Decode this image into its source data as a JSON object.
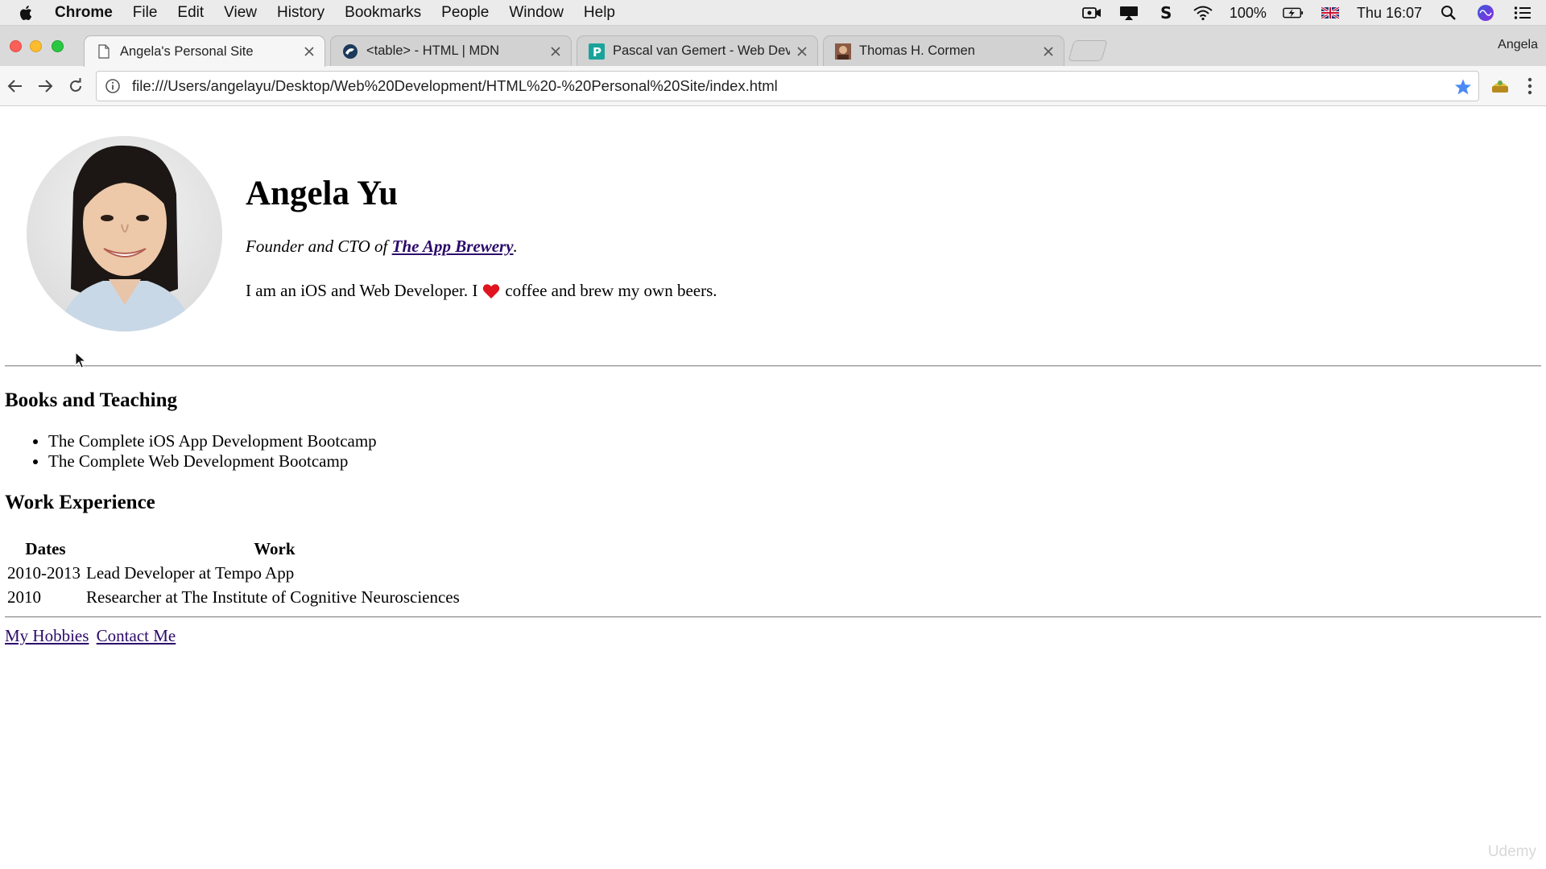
{
  "menubar": {
    "app_name": "Chrome",
    "items": [
      "File",
      "Edit",
      "View",
      "History",
      "Bookmarks",
      "People",
      "Window",
      "Help"
    ],
    "battery": "100%",
    "clock": "Thu 16:07"
  },
  "tabs": [
    {
      "title": "Angela's Personal Site",
      "favicon": "page-icon"
    },
    {
      "title": "<table> - HTML | MDN",
      "favicon": "mdn-icon"
    },
    {
      "title": "Pascal van Gemert - Web Developer",
      "favicon": "pascal-p-icon"
    },
    {
      "title": "Thomas H. Cormen",
      "favicon": "cormen-photo-icon"
    }
  ],
  "profile_name": "Angela",
  "toolbar": {
    "url": "file:///Users/angelayu/Desktop/Web%20Development/HTML%20-%20Personal%20Site/index.html"
  },
  "page": {
    "name": "Angela Yu",
    "tagline_prefix": "Founder and CTO of ",
    "tagline_link": "The App Brewery",
    "tagline_suffix": ".",
    "bio_before": "I am an iOS and Web Developer. I",
    "bio_after": "coffee and brew my own beers.",
    "books_title": "Books and Teaching",
    "books": [
      "The Complete iOS App Development Bootcamp",
      "The Complete Web Development Bootcamp"
    ],
    "work_title": "Work Experience",
    "work_headers": [
      "Dates",
      "Work"
    ],
    "work_rows": [
      [
        "2010-2013",
        "Lead Developer at Tempo App"
      ],
      [
        "2010",
        "Researcher at The Institute of Cognitive Neurosciences"
      ]
    ],
    "footer_links": [
      "My Hobbies",
      "Contact Me"
    ]
  },
  "watermark": "Udemy",
  "colors": {
    "link": "#2b0a6a",
    "star": "#4a8af4",
    "heart": "#e0141e"
  }
}
